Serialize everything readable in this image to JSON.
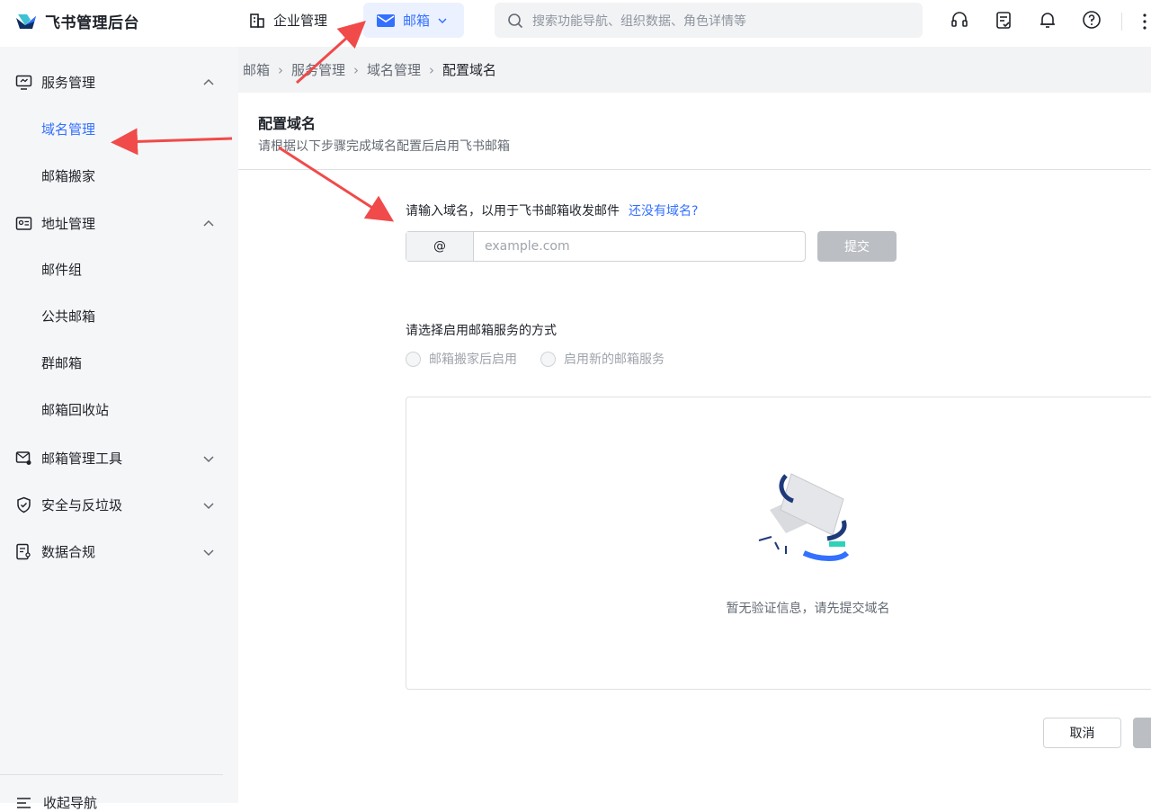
{
  "app": {
    "title": "飞书管理后台"
  },
  "topnav": {
    "company_label": "企业管理",
    "mail_label": "邮箱",
    "search_placeholder": "搜索功能导航、组织数据、角色详情等"
  },
  "sidebar": {
    "groups": [
      {
        "label": "服务管理",
        "items": [
          "域名管理",
          "邮箱搬家"
        ]
      },
      {
        "label": "地址管理",
        "items": [
          "邮件组",
          "公共邮箱",
          "群邮箱",
          "邮箱回收站"
        ]
      },
      {
        "label": "邮箱管理工具"
      },
      {
        "label": "安全与反垃圾"
      },
      {
        "label": "数据合规"
      }
    ],
    "collapse_label": "收起导航"
  },
  "breadcrumb": [
    "邮箱",
    "服务管理",
    "域名管理",
    "配置域名"
  ],
  "page": {
    "title": "配置域名",
    "subtitle": "请根据以下步骤完成域名配置后启用飞书邮箱",
    "domain_prompt": "请输入域名，以用于飞书邮箱收发邮件",
    "domain_link": "还没有域名?",
    "at_symbol": "@",
    "domain_placeholder": "example.com",
    "submit_label": "提交",
    "method_prompt": "请选择启用邮箱服务的方式",
    "radio_options": [
      "邮箱搬家后启用",
      "启用新的邮箱服务"
    ],
    "empty_text": "暂无验证信息，请先提交域名",
    "cancel_label": "取消"
  },
  "colors": {
    "accent": "#3370ff",
    "annotation": "#f04a4a",
    "sidebar_bg": "#f5f6f7"
  }
}
